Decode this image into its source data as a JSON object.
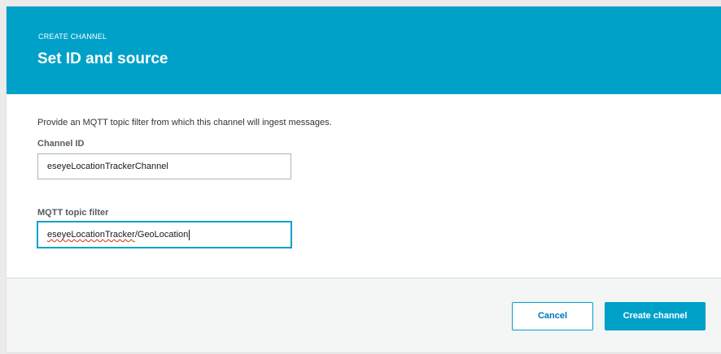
{
  "header": {
    "eyebrow": "CREATE CHANNEL",
    "title": "Set ID and source",
    "background_color": "#00a1c9"
  },
  "form": {
    "description": "Provide an MQTT topic filter from which this channel will ingest messages.",
    "channel_id": {
      "label": "Channel ID",
      "value": "eseyeLocationTrackerChannel"
    },
    "mqtt_topic_filter": {
      "label": "MQTT topic filter",
      "value_spellflagged": "eseyeLocationTracker",
      "value_rest": "/GeoLocation",
      "focused": true
    }
  },
  "footer": {
    "cancel_label": "Cancel",
    "create_label": "Create channel",
    "accent_color": "#00a1c9"
  }
}
